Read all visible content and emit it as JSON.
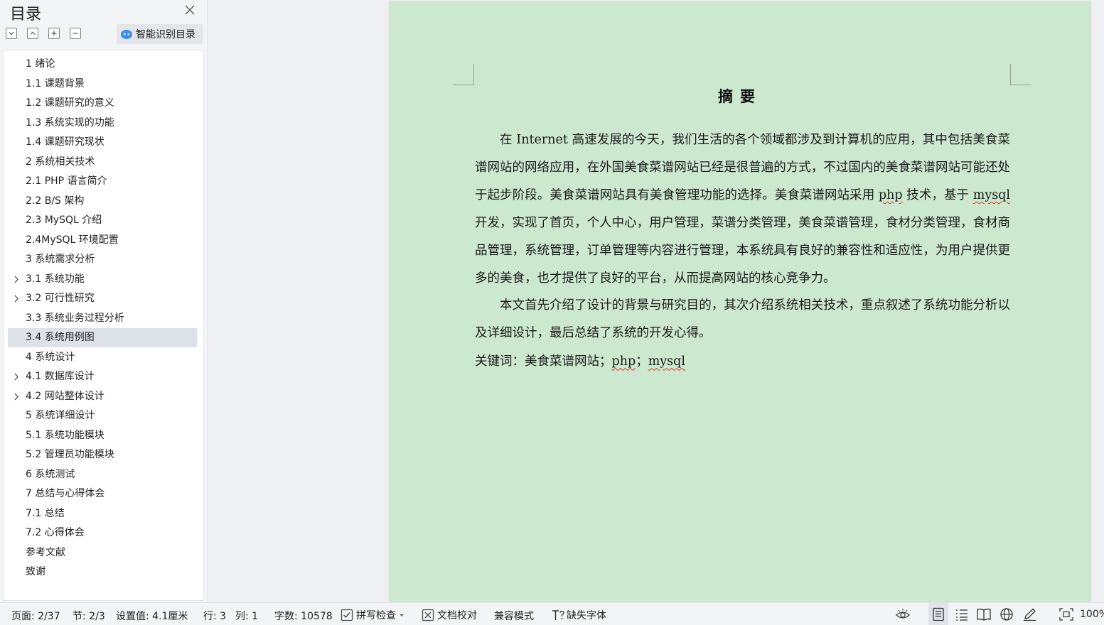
{
  "sidebar": {
    "title": "目录",
    "smart_toc_label": "智能识别目录",
    "items": [
      {
        "label": "1 绪论",
        "expandable": false,
        "active": false
      },
      {
        "label": "1.1 课题背景",
        "expandable": false,
        "active": false
      },
      {
        "label": "1.2 课题研究的意义",
        "expandable": false,
        "active": false
      },
      {
        "label": "1.3 系统实现的功能",
        "expandable": false,
        "active": false
      },
      {
        "label": "1.4 课题研究现状",
        "expandable": false,
        "active": false
      },
      {
        "label": "2 系统相关技术",
        "expandable": false,
        "active": false
      },
      {
        "label": "2.1 PHP 语言简介",
        "expandable": false,
        "active": false
      },
      {
        "label": "2.2 B/S 架构",
        "expandable": false,
        "active": false
      },
      {
        "label": "2.3 MySQL 介绍",
        "expandable": false,
        "active": false
      },
      {
        "label": "2.4MySQL 环境配置",
        "expandable": false,
        "active": false
      },
      {
        "label": "3 系统需求分析",
        "expandable": false,
        "active": false
      },
      {
        "label": "3.1 系统功能",
        "expandable": true,
        "active": false
      },
      {
        "label": "3.2 可行性研究",
        "expandable": true,
        "active": false
      },
      {
        "label": "3.3 系统业务过程分析",
        "expandable": false,
        "active": false
      },
      {
        "label": "3.4 系统用例图",
        "expandable": false,
        "active": true
      },
      {
        "label": "4 系统设计",
        "expandable": false,
        "active": false
      },
      {
        "label": "4.1 数据库设计",
        "expandable": true,
        "active": false
      },
      {
        "label": "4.2 网站整体设计",
        "expandable": true,
        "active": false
      },
      {
        "label": "5 系统详细设计",
        "expandable": false,
        "active": false
      },
      {
        "label": "5.1 系统功能模块",
        "expandable": false,
        "active": false
      },
      {
        "label": "5.2 管理员功能模块",
        "expandable": false,
        "active": false
      },
      {
        "label": "6 系统测试",
        "expandable": false,
        "active": false
      },
      {
        "label": "7 总结与心得体会",
        "expandable": false,
        "active": false
      },
      {
        "label": "7.1 总结",
        "expandable": false,
        "active": false
      },
      {
        "label": "7.2 心得体会",
        "expandable": false,
        "active": false
      },
      {
        "label": "参考文献",
        "expandable": false,
        "active": false
      },
      {
        "label": "致谢",
        "expandable": false,
        "active": false
      }
    ]
  },
  "document": {
    "heading": "摘要",
    "p1": {
      "a": "在 Internet 高速发展的今天，我们生活的各个领域都涉及到计算机的应用，其中包括美食菜谱网站的网络应用，在外国美食菜谱网站已经是很普遍的方式，不过国内的美食菜谱网站可能还处于起步阶段。美食菜谱网站具有美食管理功能的选择。美食菜谱网站采用 ",
      "php": "php",
      "b": " 技术，基于 ",
      "mysql": "mysql",
      "c": " 开发，实现了首页，个人中心，用户管理，菜谱分类管理，美食菜谱管理，食材分类管理，食材商品管理，系统管理，订单管理等内容进行管理，本系统具有良好的兼容性和适应性，为用户提供更多的美食，也才提供了良好的平台，从而提高网站的核心竞争力。"
    },
    "p2": "本文首先介绍了设计的背景与研究目的，其次介绍系统相关技术，重点叙述了系统功能分析以及详细设计，最后总结了系统的开发心得。",
    "keywords": {
      "label": "关键词：美食菜谱网站；",
      "php": "php",
      "sep": "；",
      "mysql": "mysql"
    }
  },
  "statusbar": {
    "page": "页面: 2/37",
    "section": "节: 2/3",
    "setting": "设置值: 4.1厘米",
    "row": "行: 3",
    "col": "列: 1",
    "wordcount": "字数: 10578",
    "spellcheck": "拼写检查",
    "proofread": "文档校对",
    "compat": "兼容模式",
    "missing_font": "缺失字体",
    "zoom": "100%"
  },
  "colors": {
    "page_background": "#cce8cf",
    "active_item": "#dde1e8",
    "spell_error": "#d9342b",
    "ai_icon": "#3b8cf0"
  }
}
